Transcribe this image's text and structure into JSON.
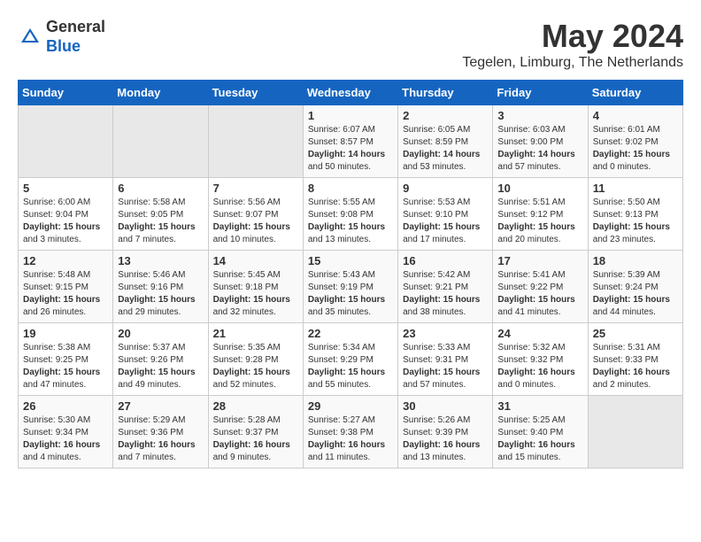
{
  "logo": {
    "general": "General",
    "blue": "Blue"
  },
  "header": {
    "month": "May 2024",
    "location": "Tegelen, Limburg, The Netherlands"
  },
  "weekdays": [
    "Sunday",
    "Monday",
    "Tuesday",
    "Wednesday",
    "Thursday",
    "Friday",
    "Saturday"
  ],
  "weeks": [
    [
      {
        "day": "",
        "info": ""
      },
      {
        "day": "",
        "info": ""
      },
      {
        "day": "",
        "info": ""
      },
      {
        "day": "1",
        "info": "Sunrise: 6:07 AM\nSunset: 8:57 PM\nDaylight: 14 hours\nand 50 minutes."
      },
      {
        "day": "2",
        "info": "Sunrise: 6:05 AM\nSunset: 8:59 PM\nDaylight: 14 hours\nand 53 minutes."
      },
      {
        "day": "3",
        "info": "Sunrise: 6:03 AM\nSunset: 9:00 PM\nDaylight: 14 hours\nand 57 minutes."
      },
      {
        "day": "4",
        "info": "Sunrise: 6:01 AM\nSunset: 9:02 PM\nDaylight: 15 hours\nand 0 minutes."
      }
    ],
    [
      {
        "day": "5",
        "info": "Sunrise: 6:00 AM\nSunset: 9:04 PM\nDaylight: 15 hours\nand 3 minutes."
      },
      {
        "day": "6",
        "info": "Sunrise: 5:58 AM\nSunset: 9:05 PM\nDaylight: 15 hours\nand 7 minutes."
      },
      {
        "day": "7",
        "info": "Sunrise: 5:56 AM\nSunset: 9:07 PM\nDaylight: 15 hours\nand 10 minutes."
      },
      {
        "day": "8",
        "info": "Sunrise: 5:55 AM\nSunset: 9:08 PM\nDaylight: 15 hours\nand 13 minutes."
      },
      {
        "day": "9",
        "info": "Sunrise: 5:53 AM\nSunset: 9:10 PM\nDaylight: 15 hours\nand 17 minutes."
      },
      {
        "day": "10",
        "info": "Sunrise: 5:51 AM\nSunset: 9:12 PM\nDaylight: 15 hours\nand 20 minutes."
      },
      {
        "day": "11",
        "info": "Sunrise: 5:50 AM\nSunset: 9:13 PM\nDaylight: 15 hours\nand 23 minutes."
      }
    ],
    [
      {
        "day": "12",
        "info": "Sunrise: 5:48 AM\nSunset: 9:15 PM\nDaylight: 15 hours\nand 26 minutes."
      },
      {
        "day": "13",
        "info": "Sunrise: 5:46 AM\nSunset: 9:16 PM\nDaylight: 15 hours\nand 29 minutes."
      },
      {
        "day": "14",
        "info": "Sunrise: 5:45 AM\nSunset: 9:18 PM\nDaylight: 15 hours\nand 32 minutes."
      },
      {
        "day": "15",
        "info": "Sunrise: 5:43 AM\nSunset: 9:19 PM\nDaylight: 15 hours\nand 35 minutes."
      },
      {
        "day": "16",
        "info": "Sunrise: 5:42 AM\nSunset: 9:21 PM\nDaylight: 15 hours\nand 38 minutes."
      },
      {
        "day": "17",
        "info": "Sunrise: 5:41 AM\nSunset: 9:22 PM\nDaylight: 15 hours\nand 41 minutes."
      },
      {
        "day": "18",
        "info": "Sunrise: 5:39 AM\nSunset: 9:24 PM\nDaylight: 15 hours\nand 44 minutes."
      }
    ],
    [
      {
        "day": "19",
        "info": "Sunrise: 5:38 AM\nSunset: 9:25 PM\nDaylight: 15 hours\nand 47 minutes."
      },
      {
        "day": "20",
        "info": "Sunrise: 5:37 AM\nSunset: 9:26 PM\nDaylight: 15 hours\nand 49 minutes."
      },
      {
        "day": "21",
        "info": "Sunrise: 5:35 AM\nSunset: 9:28 PM\nDaylight: 15 hours\nand 52 minutes."
      },
      {
        "day": "22",
        "info": "Sunrise: 5:34 AM\nSunset: 9:29 PM\nDaylight: 15 hours\nand 55 minutes."
      },
      {
        "day": "23",
        "info": "Sunrise: 5:33 AM\nSunset: 9:31 PM\nDaylight: 15 hours\nand 57 minutes."
      },
      {
        "day": "24",
        "info": "Sunrise: 5:32 AM\nSunset: 9:32 PM\nDaylight: 16 hours\nand 0 minutes."
      },
      {
        "day": "25",
        "info": "Sunrise: 5:31 AM\nSunset: 9:33 PM\nDaylight: 16 hours\nand 2 minutes."
      }
    ],
    [
      {
        "day": "26",
        "info": "Sunrise: 5:30 AM\nSunset: 9:34 PM\nDaylight: 16 hours\nand 4 minutes."
      },
      {
        "day": "27",
        "info": "Sunrise: 5:29 AM\nSunset: 9:36 PM\nDaylight: 16 hours\nand 7 minutes."
      },
      {
        "day": "28",
        "info": "Sunrise: 5:28 AM\nSunset: 9:37 PM\nDaylight: 16 hours\nand 9 minutes."
      },
      {
        "day": "29",
        "info": "Sunrise: 5:27 AM\nSunset: 9:38 PM\nDaylight: 16 hours\nand 11 minutes."
      },
      {
        "day": "30",
        "info": "Sunrise: 5:26 AM\nSunset: 9:39 PM\nDaylight: 16 hours\nand 13 minutes."
      },
      {
        "day": "31",
        "info": "Sunrise: 5:25 AM\nSunset: 9:40 PM\nDaylight: 16 hours\nand 15 minutes."
      },
      {
        "day": "",
        "info": ""
      }
    ]
  ]
}
